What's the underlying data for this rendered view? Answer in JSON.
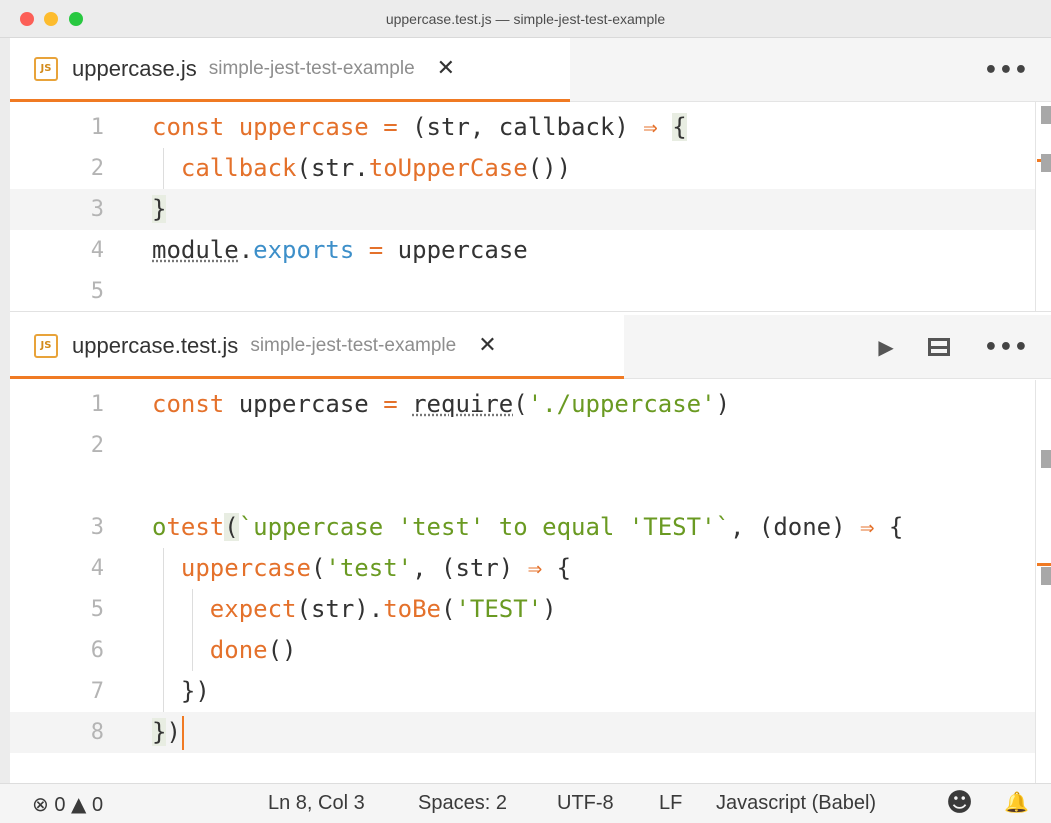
{
  "window": {
    "title": "uppercase.test.js — simple-jest-test-example"
  },
  "pane1": {
    "tab": {
      "filename": "uppercase.js",
      "folder": "simple-jest-test-example",
      "close": "✕",
      "badge": "JS"
    },
    "more": "•••",
    "lines": [
      {
        "num": "1",
        "tokens": [
          [
            "k",
            "const"
          ],
          [
            "pl",
            " "
          ],
          [
            "k",
            "uppercase"
          ],
          [
            "pl",
            " "
          ],
          [
            "k",
            "="
          ],
          [
            "pl",
            " (str, callback) "
          ],
          [
            "arrow",
            "⇒"
          ],
          [
            "pl",
            " "
          ],
          [
            "brk",
            "{"
          ]
        ]
      },
      {
        "num": "2",
        "tokens": [
          [
            "pl",
            "  "
          ],
          [
            "f",
            "callback"
          ],
          [
            "pl",
            "(str."
          ],
          [
            "f",
            "toUpperCase"
          ],
          [
            "pl",
            "())"
          ]
        ]
      },
      {
        "num": "3",
        "tokens": [
          [
            "brk",
            "}"
          ]
        ]
      },
      {
        "num": "4",
        "tokens": [
          [
            "ul",
            "module"
          ],
          [
            "pl",
            "."
          ],
          [
            "p",
            "exports"
          ],
          [
            "pl",
            " "
          ],
          [
            "k",
            "="
          ],
          [
            "pl",
            " uppercase"
          ]
        ]
      },
      {
        "num": "5",
        "tokens": []
      }
    ]
  },
  "pane2": {
    "tab": {
      "filename": "uppercase.test.js",
      "folder": "simple-jest-test-example",
      "close": "✕",
      "badge": "JS"
    },
    "run": "▶",
    "more": "•••",
    "lines": [
      {
        "num": "1",
        "tokens": [
          [
            "k",
            "const"
          ],
          [
            "pl",
            " uppercase "
          ],
          [
            "k",
            "="
          ],
          [
            "pl",
            " "
          ],
          [
            "ul",
            "require"
          ],
          [
            "pl",
            "("
          ],
          [
            "s",
            "'./uppercase'"
          ],
          [
            "pl",
            ")"
          ]
        ]
      },
      {
        "num": "2",
        "tokens": []
      },
      {
        "num": "3",
        "tokens": [
          [
            "s",
            "o"
          ],
          [
            "f",
            "test"
          ],
          [
            "brk",
            "("
          ],
          [
            "s",
            "`uppercase 'test' to equal 'TEST'`"
          ],
          [
            "pl",
            ", (done) "
          ],
          [
            "arrow",
            "⇒"
          ],
          [
            "pl",
            " {"
          ]
        ]
      },
      {
        "num": "4",
        "tokens": [
          [
            "pl",
            "  "
          ],
          [
            "f",
            "uppercase"
          ],
          [
            "pl",
            "("
          ],
          [
            "s",
            "'test'"
          ],
          [
            "pl",
            ", (str) "
          ],
          [
            "arrow",
            "⇒"
          ],
          [
            "pl",
            " {"
          ]
        ]
      },
      {
        "num": "5",
        "tokens": [
          [
            "pl",
            "    "
          ],
          [
            "f",
            "expect"
          ],
          [
            "pl",
            "(str)."
          ],
          [
            "f",
            "toBe"
          ],
          [
            "pl",
            "("
          ],
          [
            "s",
            "'TEST'"
          ],
          [
            "pl",
            ")"
          ]
        ]
      },
      {
        "num": "6",
        "tokens": [
          [
            "pl",
            "    "
          ],
          [
            "f",
            "done"
          ],
          [
            "pl",
            "()"
          ]
        ]
      },
      {
        "num": "7",
        "tokens": [
          [
            "pl",
            "  })"
          ]
        ]
      },
      {
        "num": "8",
        "tokens": [
          [
            "brk",
            "}"
          ],
          [
            "pl",
            ")"
          ]
        ]
      }
    ]
  },
  "status": {
    "errors": "0",
    "warnings": "0",
    "position": "Ln 8, Col 3",
    "spaces": "Spaces: 2",
    "encoding": "UTF-8",
    "eol": "LF",
    "language": "Javascript (Babel)",
    "error_icon": "⊗",
    "warning_icon": "▲",
    "smiley_icon": "☻",
    "bell_icon": "🔔"
  }
}
